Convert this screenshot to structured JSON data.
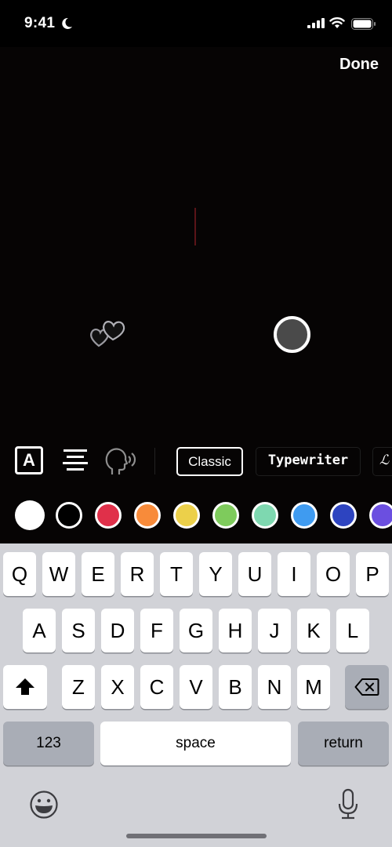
{
  "status_bar": {
    "time": "9:41",
    "focus_icon": "moon-icon",
    "signal_icon": "cellular-signal-icon",
    "wifi_icon": "wifi-icon",
    "battery_icon": "battery-icon"
  },
  "editor": {
    "done_label": "Done",
    "sticker_icon": "hearts-sticker-icon",
    "color_knob_color": "#4a4a4a"
  },
  "toolbar": {
    "text_style_label": "A",
    "align_icon": "align-center-icon",
    "voice_icon": "text-to-speech-icon",
    "fonts": [
      {
        "label": "Classic",
        "selected": true
      },
      {
        "label": "Typewriter",
        "selected": false
      },
      {
        "label": "ℒ",
        "selected": false
      }
    ]
  },
  "colors": [
    {
      "name": "white",
      "hex": "#ffffff",
      "selected": true
    },
    {
      "name": "black",
      "hex": "#000000",
      "selected": false
    },
    {
      "name": "red",
      "hex": "#e0304a",
      "selected": false
    },
    {
      "name": "orange",
      "hex": "#f88b3a",
      "selected": false
    },
    {
      "name": "yellow",
      "hex": "#ecd04a",
      "selected": false
    },
    {
      "name": "green",
      "hex": "#7ecb5c",
      "selected": false
    },
    {
      "name": "mint",
      "hex": "#7ed8b0",
      "selected": false
    },
    {
      "name": "sky-blue",
      "hex": "#3f9bf0",
      "selected": false
    },
    {
      "name": "navy",
      "hex": "#2d44c0",
      "selected": false
    },
    {
      "name": "purple",
      "hex": "#6b4fe0",
      "selected": false
    }
  ],
  "keyboard": {
    "row1": [
      "Q",
      "W",
      "E",
      "R",
      "T",
      "Y",
      "U",
      "I",
      "O",
      "P"
    ],
    "row2": [
      "A",
      "S",
      "D",
      "F",
      "G",
      "H",
      "J",
      "K",
      "L"
    ],
    "row3": [
      "Z",
      "X",
      "C",
      "V",
      "B",
      "N",
      "M"
    ],
    "shift_icon": "shift-icon",
    "delete_icon": "delete-icon",
    "numbers_label": "123",
    "space_label": "space",
    "return_label": "return",
    "emoji_icon": "emoji-icon",
    "mic_icon": "microphone-icon"
  }
}
